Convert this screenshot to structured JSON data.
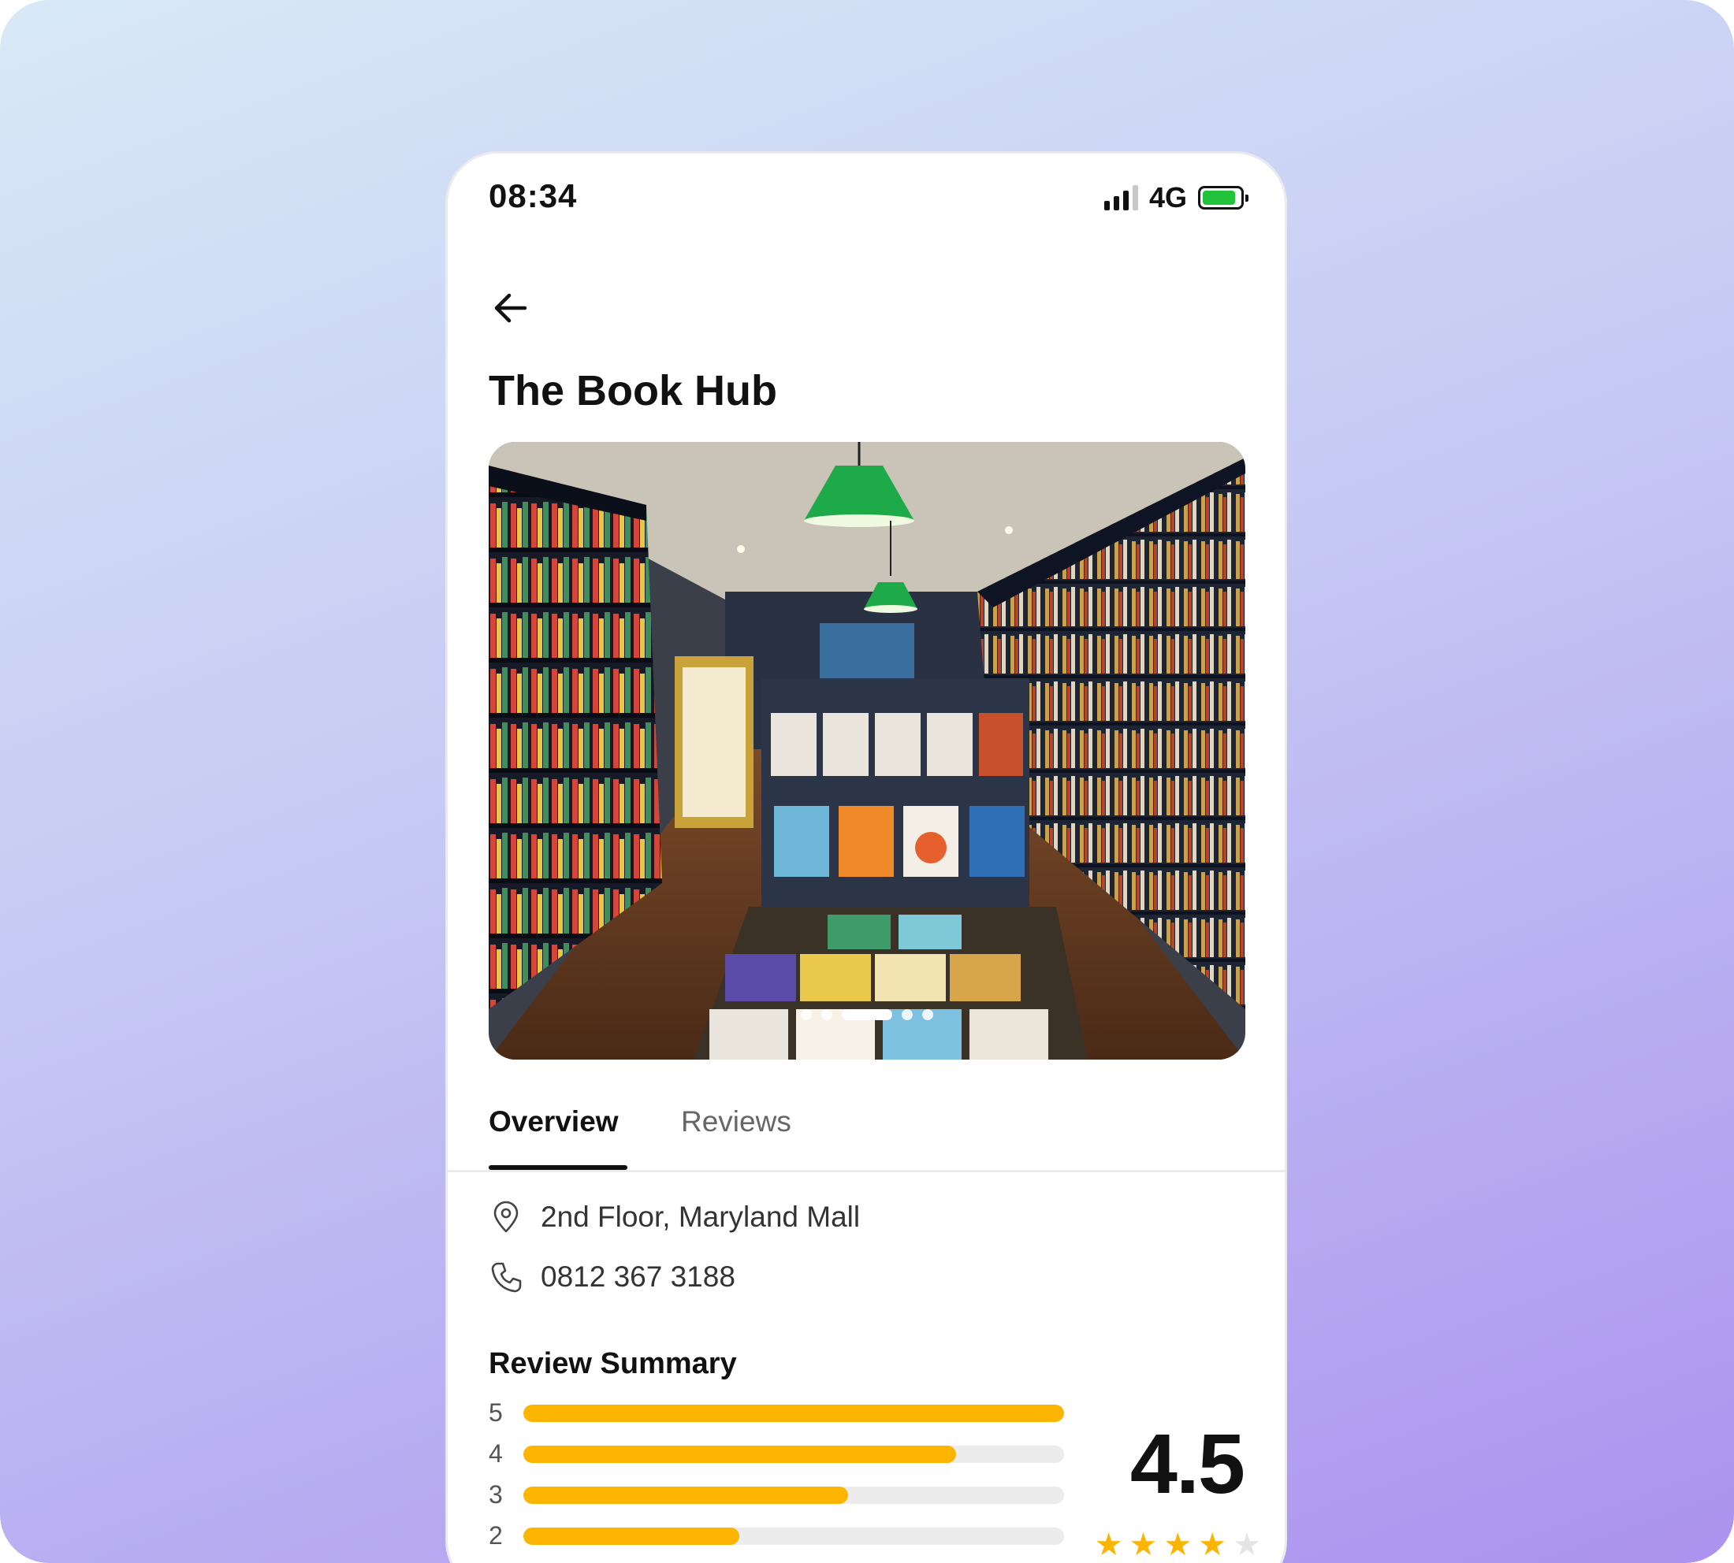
{
  "status": {
    "time": "08:34",
    "network": "4G",
    "battery_level": 0.9,
    "signal_bars": 3,
    "battery_color": "#22c33b"
  },
  "header": {
    "back_icon": "arrow-left-icon",
    "title": "The Book Hub"
  },
  "gallery": {
    "image": "bookstore-interior-photo",
    "slide_count": 5,
    "active_slide": 3
  },
  "tabs": [
    {
      "label": "Overview",
      "active": true
    },
    {
      "label": "Reviews",
      "active": false
    }
  ],
  "info": {
    "address": "2nd Floor, Maryland Mall",
    "address_icon": "location-pin-icon",
    "phone": "0812 367 3188",
    "phone_icon": "phone-icon"
  },
  "review_summary": {
    "title": "Review Summary",
    "average": "4.5",
    "stars_filled": 4,
    "stars_total": 5,
    "accent_color": "#fbb500",
    "distribution": [
      {
        "rating": "5",
        "fraction": 1.0
      },
      {
        "rating": "4",
        "fraction": 0.8
      },
      {
        "rating": "3",
        "fraction": 0.6
      },
      {
        "rating": "2",
        "fraction": 0.4
      }
    ]
  }
}
